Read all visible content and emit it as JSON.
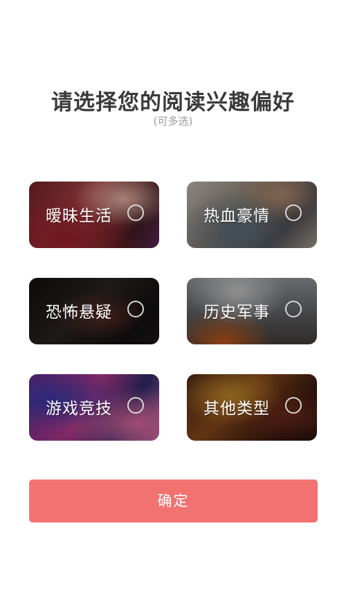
{
  "header": {
    "title": "请选择您的阅读兴趣偏好",
    "subtitle": "(可多选)"
  },
  "genres": [
    {
      "label": "暧昧生活",
      "selected": false
    },
    {
      "label": "热血豪情",
      "selected": false
    },
    {
      "label": "恐怖悬疑",
      "selected": false
    },
    {
      "label": "历史军事",
      "selected": false
    },
    {
      "label": "游戏竞技",
      "selected": false
    },
    {
      "label": "其他类型",
      "selected": false
    }
  ],
  "confirm": {
    "label": "确定",
    "color": "#f27271"
  }
}
